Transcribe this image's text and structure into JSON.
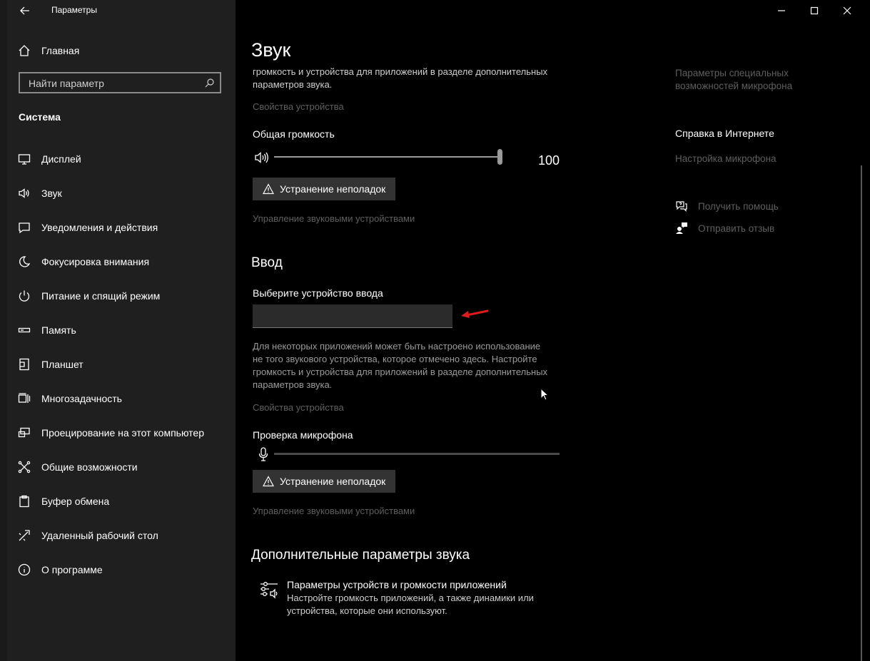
{
  "window": {
    "title": "Параметры"
  },
  "sidebar": {
    "home": "Главная",
    "search_placeholder": "Найти параметр",
    "section": "Система",
    "items": [
      {
        "label": "Дисплей",
        "icon": "monitor-icon"
      },
      {
        "label": "Звук",
        "icon": "speaker-icon"
      },
      {
        "label": "Уведомления и действия",
        "icon": "notification-icon"
      },
      {
        "label": "Фокусировка внимания",
        "icon": "moon-icon"
      },
      {
        "label": "Питание и спящий режим",
        "icon": "power-icon"
      },
      {
        "label": "Память",
        "icon": "storage-icon"
      },
      {
        "label": "Планшет",
        "icon": "tablet-icon"
      },
      {
        "label": "Многозадачность",
        "icon": "multitask-icon"
      },
      {
        "label": "Проецирование на этот компьютер",
        "icon": "project-icon"
      },
      {
        "label": "Общие возможности",
        "icon": "shared-icon"
      },
      {
        "label": "Буфер обмена",
        "icon": "clipboard-icon"
      },
      {
        "label": "Удаленный рабочий стол",
        "icon": "remote-desktop-icon"
      },
      {
        "label": "О программе",
        "icon": "info-icon"
      }
    ]
  },
  "main": {
    "title": "Звук",
    "output": {
      "desc_line1": "громкость и устройства для приложений в разделе дополнительных",
      "desc_line2": "параметров звука.",
      "device_props": "Свойства устройства",
      "volume_label": "Общая громкость",
      "volume_value": "100",
      "troubleshoot": "Устранение неполадок",
      "manage_devices": "Управление звуковыми устройствами"
    },
    "input": {
      "heading": "Ввод",
      "select_label": "Выберите устройство ввода",
      "select_value": "",
      "desc_line1": "Для некоторых приложений может быть настроено использование",
      "desc_line2": "не того звукового устройства, которое отмечено здесь. Настройте",
      "desc_line3": "громкость и устройства для приложений в разделе дополнительных",
      "desc_line4": "параметров звука.",
      "device_props": "Свойства устройства",
      "mic_test_label": "Проверка микрофона",
      "troubleshoot": "Устранение неполадок",
      "manage_devices": "Управление звуковыми устройствами"
    },
    "advanced": {
      "heading": "Дополнительные параметры звука",
      "item_title": "Параметры устройств и громкости приложений",
      "item_desc_line1": "Настройте громкость приложений, а также динамики или",
      "item_desc_line2": "устройства, которые они используют."
    }
  },
  "right": {
    "mic_accessibility_line1": "Параметры специальных",
    "mic_accessibility_line2": "возможностей микрофона",
    "help_heading": "Справка в Интернете",
    "mic_setup": "Настройка микрофона",
    "get_help": "Получить помощь",
    "send_feedback": "Отправить отзыв"
  },
  "colors": {
    "annotation_arrow": "#e01b1b"
  }
}
